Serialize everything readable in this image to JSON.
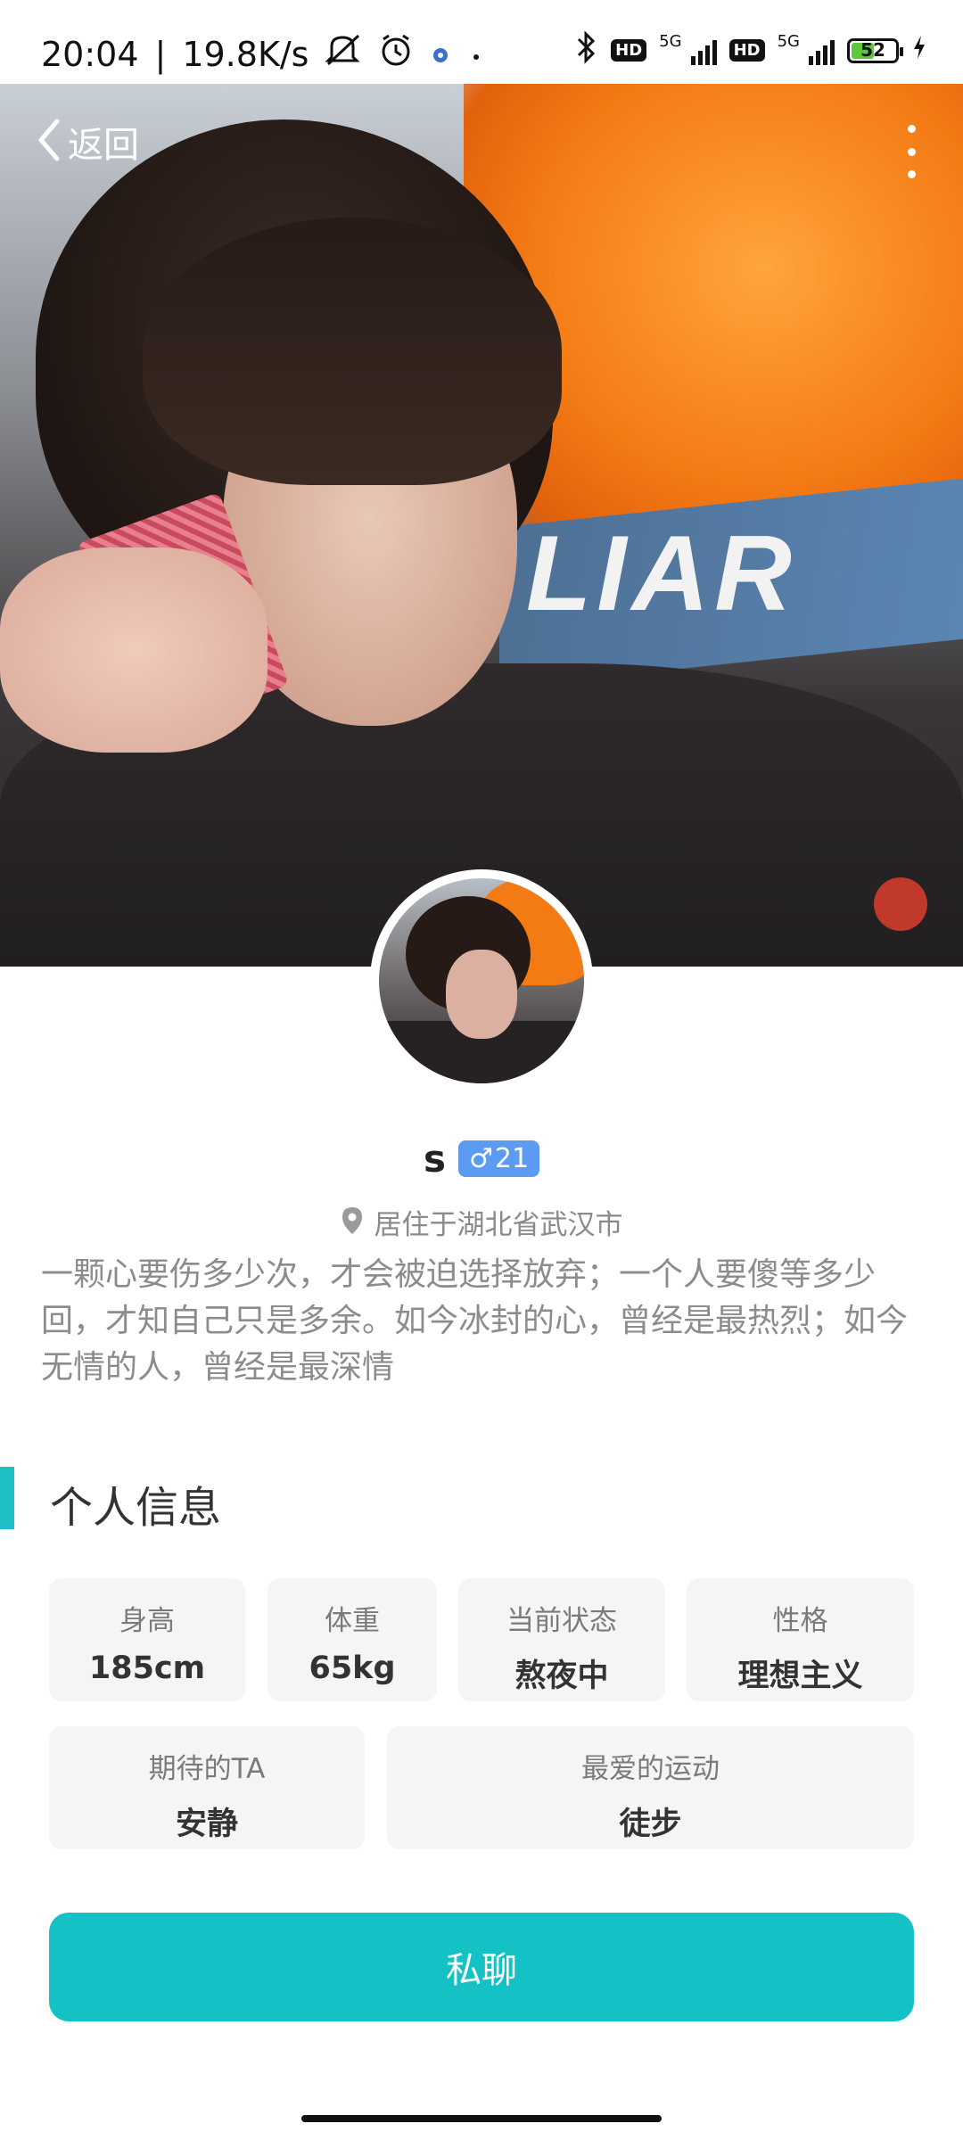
{
  "status_bar": {
    "time": "20:04",
    "speed": "19.8K/s",
    "network1": "5G",
    "network2": "5G",
    "hd": "HD",
    "battery": "52",
    "battery_level": 0.52
  },
  "nav": {
    "back_label": "返回"
  },
  "profile": {
    "name": "s",
    "gender_symbol": "♂",
    "age": "21",
    "location": "居住于湖北省武汉市",
    "bio": "一颗心要伤多少次，才会被迫选择放弃；一个人要傻等多少回，才知自己只是多余。如今冰封的心，曾经是最热烈；如今无情的人，曾经是最深情"
  },
  "cover_text": "LIAR",
  "section": {
    "title": "个人信息"
  },
  "info": [
    {
      "label": "身高",
      "value": "185cm"
    },
    {
      "label": "体重",
      "value": "65kg"
    },
    {
      "label": "当前状态",
      "value": "熬夜中"
    },
    {
      "label": "性格",
      "value": "理想主义"
    },
    {
      "label": "期待的TA",
      "value": "安静"
    },
    {
      "label": "最爱的运动",
      "value": "徒步"
    }
  ],
  "actions": {
    "chat_label": "私聊"
  },
  "colors": {
    "accent": "#14c2c5",
    "gender_badge": "#5b9cf2",
    "chip_bg": "#f5f5f5"
  }
}
